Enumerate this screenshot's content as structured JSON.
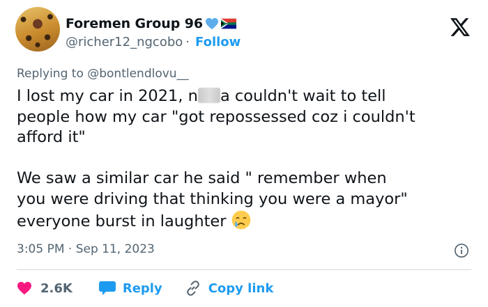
{
  "author": {
    "display_name": "Foremen Group 96",
    "handle": "@richer12_ngcobo",
    "separator": "·",
    "follow_label": "Follow"
  },
  "reply_context": "Replying to @bontlendlovu__",
  "tweet": {
    "line1_a": "I lost my car in 2021, n",
    "line1_b": "a couldn't wait to tell\npeople how my car \"got repossessed coz i couldn't\nafford it\"\n\nWe saw a similar car he said \" remember when\nyou were driving that thinking you were a mayor\"\neveryone burst in laughter",
    "emoji": "crying-face"
  },
  "timestamp": "3:05 PM · Sep 11, 2023",
  "actions": {
    "like_count": "2.6K",
    "reply_label": "Reply",
    "copy_label": "Copy link"
  },
  "colors": {
    "accent": "#1d9bf0",
    "like": "#f91880",
    "secondary_text": "#536471",
    "text": "#0f1419",
    "divider": "#cfd9de"
  },
  "icons": [
    "blue-heart-icon",
    "south-africa-flag-icon",
    "x-logo-icon",
    "info-icon",
    "heart-icon",
    "speech-bubble-icon",
    "link-icon",
    "crying-face-icon"
  ]
}
